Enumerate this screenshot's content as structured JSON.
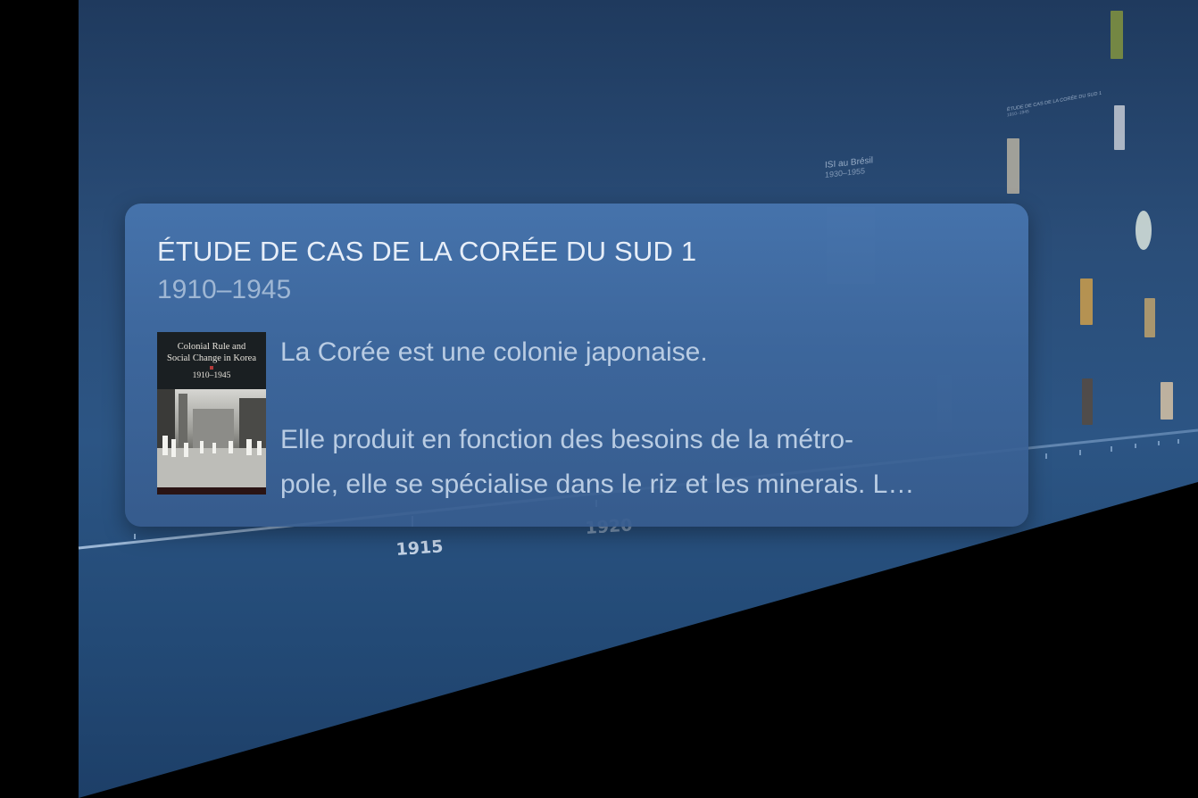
{
  "card": {
    "title": "ÉTUDE DE CAS DE LA CORÉE DU SUD 1",
    "date_range": "1910–1945",
    "book_cover": {
      "title_line1": "Colonial Rule and",
      "title_line2": "Social Change in Korea",
      "dates": "1910–1945"
    },
    "paragraph1": "La Corée est une colonie japonaise.",
    "paragraph2_line1": "Elle produit en fonction des besoins de la métro-",
    "paragraph2_line2": "pole, elle se spécialise dans le riz et les minerais. L…"
  },
  "timeline": {
    "years": [
      "1915",
      "1920"
    ]
  },
  "background_events": [
    {
      "title": "ISI au Brésil",
      "date": "1930–1955"
    },
    {
      "title": "ÉTUDE DE CAS DE LA CORÉE DU SUD 1",
      "date": "1910–1945"
    }
  ],
  "colors": {
    "wall": "#2a4d78",
    "card": "#4876b0",
    "title_text": "#e7eef8",
    "date_text": "#9fb7d4",
    "body_text": "#b9cce3"
  }
}
